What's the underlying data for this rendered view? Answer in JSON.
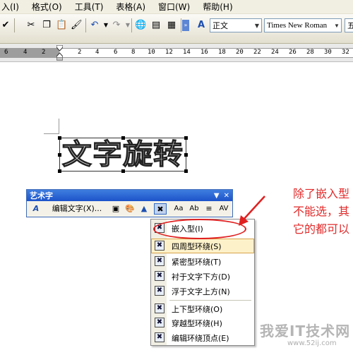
{
  "menubar": {
    "items": [
      "入(I)",
      "格式(O)",
      "工具(T)",
      "表格(A)",
      "窗口(W)",
      "帮助(H)"
    ]
  },
  "toolbar": {
    "style_value": "正文",
    "font_value": "Times New Roman",
    "size_value": "五"
  },
  "ruler": {
    "numbers": [
      "6",
      "4",
      "2",
      "2",
      "4",
      "6",
      "8",
      "10",
      "12",
      "14",
      "16",
      "18",
      "20",
      "22",
      "24",
      "26",
      "28",
      "30",
      "32"
    ]
  },
  "document": {
    "wordart_text": "文字旋转"
  },
  "wordart_toolbar": {
    "title": "艺术字",
    "edit_text_label": "编辑文字(X)...",
    "letter_height_label": "Aa",
    "vertical_label": "Ab",
    "spacing_label": "AV"
  },
  "wrap_menu": {
    "items": [
      {
        "label": "嵌入型(I)",
        "icon": "inline-wrap-icon"
      },
      {
        "label": "四周型环绕(S)",
        "icon": "square-wrap-icon"
      },
      {
        "label": "紧密型环绕(T)",
        "icon": "tight-wrap-icon"
      },
      {
        "label": "衬于文字下方(D)",
        "icon": "behind-text-icon"
      },
      {
        "label": "浮于文字上方(N)",
        "icon": "in-front-text-icon"
      },
      {
        "label": "上下型环绕(O)",
        "icon": "top-bottom-wrap-icon"
      },
      {
        "label": "穿越型环绕(H)",
        "icon": "through-wrap-icon"
      },
      {
        "label": "编辑环绕顶点(E)",
        "icon": "edit-wrap-points-icon"
      }
    ],
    "highlighted_index": 1
  },
  "annotation": {
    "lines": [
      "除了嵌入型",
      "不能选，其",
      "它的都可以"
    ],
    "color": "#e22a2a"
  },
  "watermark": {
    "text": "我爱IT技术网",
    "url": "www.52ij.com"
  }
}
